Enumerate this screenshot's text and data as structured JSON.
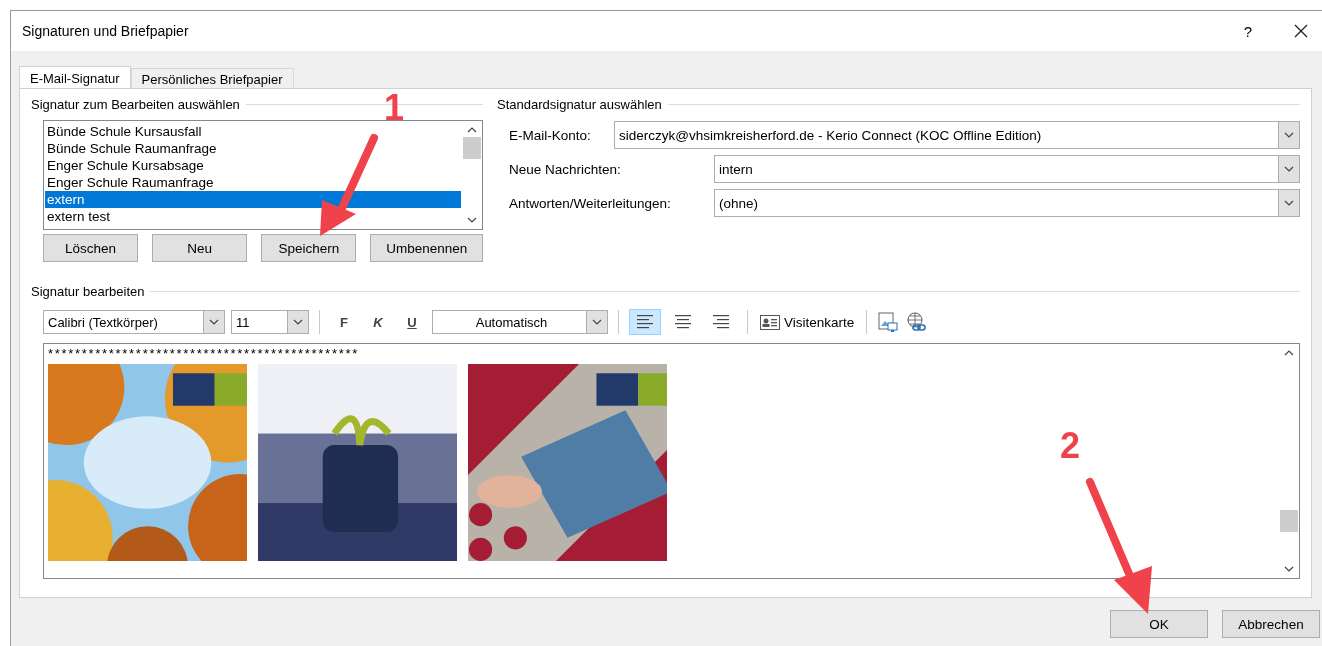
{
  "window": {
    "title": "Signaturen und Briefpapier",
    "help": "?"
  },
  "tabs": [
    {
      "label": "E-Mail-Signatur",
      "selected": true
    },
    {
      "label": "Persönliches Briefpapier",
      "selected": false
    }
  ],
  "signature_list": {
    "heading": "Signatur zum Bearbeiten auswählen",
    "items": [
      {
        "label": "Bünde Schule Kursausfall",
        "selected": false
      },
      {
        "label": "Bünde Schule Raumanfrage",
        "selected": false
      },
      {
        "label": "Enger Schule Kursabsage",
        "selected": false
      },
      {
        "label": "Enger Schule Raumanfrage",
        "selected": false
      },
      {
        "label": "extern",
        "selected": true
      },
      {
        "label": "extern test",
        "selected": false
      }
    ],
    "buttons": [
      "Löschen",
      "Neu",
      "Speichern",
      "Umbenennen"
    ]
  },
  "defaults": {
    "heading": "Standardsignatur auswählen",
    "fields": [
      {
        "label": "E-Mail-Konto:",
        "value": "siderczyk@vhsimkreisherford.de - Kerio Connect (KOC Offline Edition)"
      },
      {
        "label": "Neue Nachrichten:",
        "value": "intern"
      },
      {
        "label": "Antworten/Weiterleitungen:",
        "value": "(ohne)"
      }
    ]
  },
  "editor": {
    "heading": "Signatur bearbeiten",
    "font": "Calibri (Textkörper)",
    "size": "11",
    "format_buttons": [
      "F",
      "K",
      "U"
    ],
    "font_color_choice": "Automatisch",
    "align": [
      {
        "kind": "left",
        "selected": true
      },
      {
        "kind": "center",
        "selected": false
      },
      {
        "kind": "right",
        "selected": false
      }
    ],
    "business_card": "Visitenkarte",
    "body_line": "**********************************************",
    "pictures": [
      {
        "kind": "picture"
      },
      {
        "kind": "picture"
      },
      {
        "kind": "picture"
      }
    ]
  },
  "footer_buttons": [
    "OK",
    "Abbrechen"
  ],
  "annotations": [
    {
      "label": "1"
    },
    {
      "label": "2"
    }
  ]
}
